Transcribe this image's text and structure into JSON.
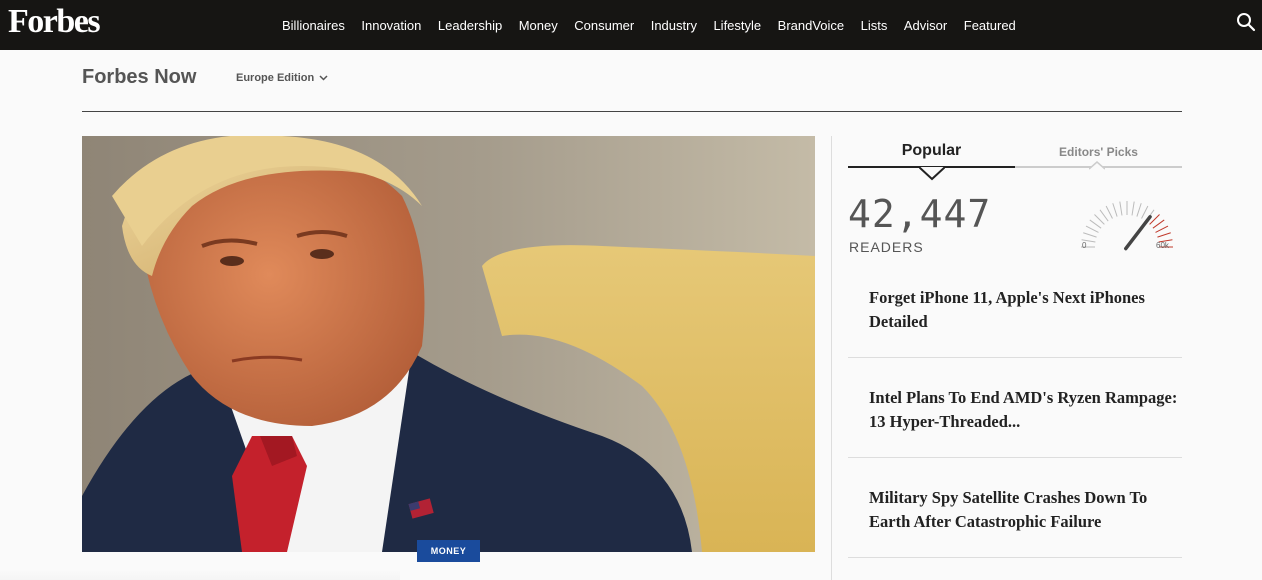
{
  "brand": {
    "logo": "Forbes"
  },
  "nav": {
    "items": [
      "Billionaires",
      "Innovation",
      "Leadership",
      "Money",
      "Consumer",
      "Industry",
      "Lifestyle",
      "BrandVoice",
      "Lists",
      "Advisor",
      "Featured"
    ]
  },
  "header": {
    "title": "Forbes Now",
    "edition": "Europe Edition"
  },
  "hero": {
    "tag": "MONEY"
  },
  "sidebar": {
    "tabs": {
      "popular": "Popular",
      "editors": "Editors' Picks"
    },
    "readers_count": "42,447",
    "readers_label": "READERS",
    "gauge": {
      "min_label": "0",
      "max_label": "60k",
      "value": 42447,
      "max": 60000
    },
    "stories": [
      {
        "title": "Forget iPhone 11, Apple's Next iPhones Detailed"
      },
      {
        "title": "Intel Plans To End AMD's Ryzen Rampage: 13 Hyper-Threaded..."
      },
      {
        "title": "Military Spy Satellite Crashes Down To Earth After Catastrophic Failure"
      }
    ]
  },
  "colors": {
    "topbar": "#161513",
    "tag": "#1a4b9c",
    "gauge_hot": "#c0392b"
  }
}
